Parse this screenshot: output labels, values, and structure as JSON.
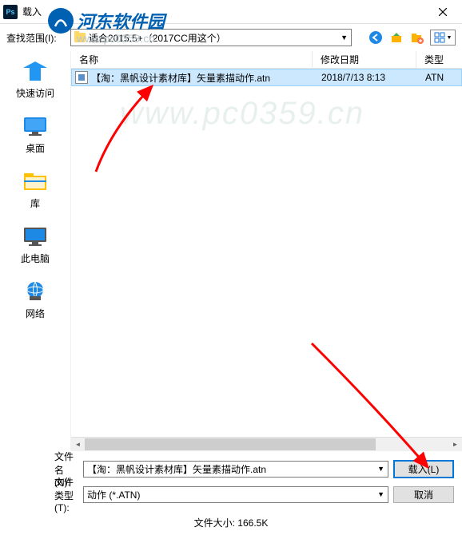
{
  "titlebar": {
    "app_icon_text": "Ps",
    "title": "载入"
  },
  "toprow": {
    "label": "查找范围(I):",
    "folder_name": "适合2015.5+（2017CC用这个）"
  },
  "watermark": {
    "brand": "河东软件园",
    "url": "www.pc0359.cn"
  },
  "sidebar": {
    "items": [
      {
        "label": "快速访问"
      },
      {
        "label": "桌面"
      },
      {
        "label": "库"
      },
      {
        "label": "此电脑"
      },
      {
        "label": "网络"
      }
    ]
  },
  "list": {
    "col_name": "名称",
    "col_date": "修改日期",
    "col_type": "类型",
    "rows": [
      {
        "name": "【淘：黑帆设计素材库】矢量素描动作.atn",
        "date": "2018/7/13 8:13",
        "type": "ATN"
      }
    ]
  },
  "bottom": {
    "filename_label": "文件名(N):",
    "filename_value": "【淘：黑帆设计素材库】矢量素描动作.atn",
    "filetype_label": "文件类型(T):",
    "filetype_value": "动作 (*.ATN)",
    "load_btn": "载入(L)",
    "cancel_btn": "取消",
    "filesize": "文件大小: 166.5K"
  }
}
